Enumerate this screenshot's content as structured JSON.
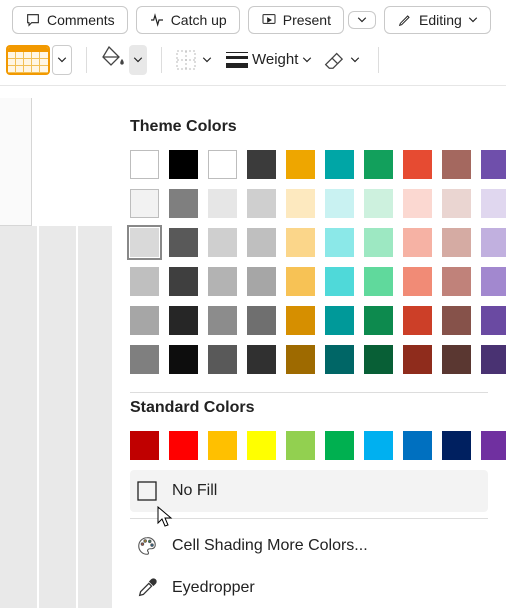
{
  "ribbon": {
    "comments": "Comments",
    "catchup": "Catch up",
    "present": "Present",
    "editing": "Editing"
  },
  "toolbar": {
    "weight_label": "Weight"
  },
  "panel": {
    "theme_title": "Theme Colors",
    "standard_title": "Standard Colors",
    "no_fill": "No Fill",
    "more_colors": "Cell Shading More Colors...",
    "eyedropper": "Eyedropper"
  },
  "theme_colors": [
    [
      "#ffffff",
      "#000000",
      "#ffffff",
      "#3b3b3b",
      "#eea600",
      "#00a6a6",
      "#12a05c",
      "#e64b32",
      "#a4685f",
      "#6f4fab"
    ],
    [
      "#f2f2f2",
      "#7f7f7f",
      "#e6e6e6",
      "#cfcfcf",
      "#fde9bf",
      "#c9f2f2",
      "#cdf1de",
      "#fbd8d1",
      "#ead5d1",
      "#e0d7ef"
    ],
    [
      "#d9d9d9",
      "#595959",
      "#cfcfcf",
      "#bfbfbf",
      "#fbd68a",
      "#8be8e8",
      "#9de8c2",
      "#f6b2a4",
      "#d5aba3",
      "#c1b0df"
    ],
    [
      "#bfbfbf",
      "#3f3f3f",
      "#b3b3b3",
      "#a6a6a6",
      "#f7c255",
      "#4fd9d9",
      "#60d99c",
      "#f18b76",
      "#c0827a",
      "#a288cf"
    ],
    [
      "#a6a6a6",
      "#262626",
      "#8c8c8c",
      "#6f6f6f",
      "#d68f00",
      "#009999",
      "#0d8a4e",
      "#cc3f28",
      "#86524a",
      "#6a4aa2"
    ],
    [
      "#7f7f7f",
      "#0d0d0d",
      "#595959",
      "#303030",
      "#9e6a00",
      "#006666",
      "#085f36",
      "#8f2c1c",
      "#5a3731",
      "#493272"
    ]
  ],
  "standard_colors": [
    "#c00000",
    "#ff0000",
    "#ffc000",
    "#ffff00",
    "#92d050",
    "#00b050",
    "#00b0f0",
    "#0070c0",
    "#002060",
    "#7030a0"
  ],
  "selected_theme": {
    "row": 2,
    "col": 0
  }
}
